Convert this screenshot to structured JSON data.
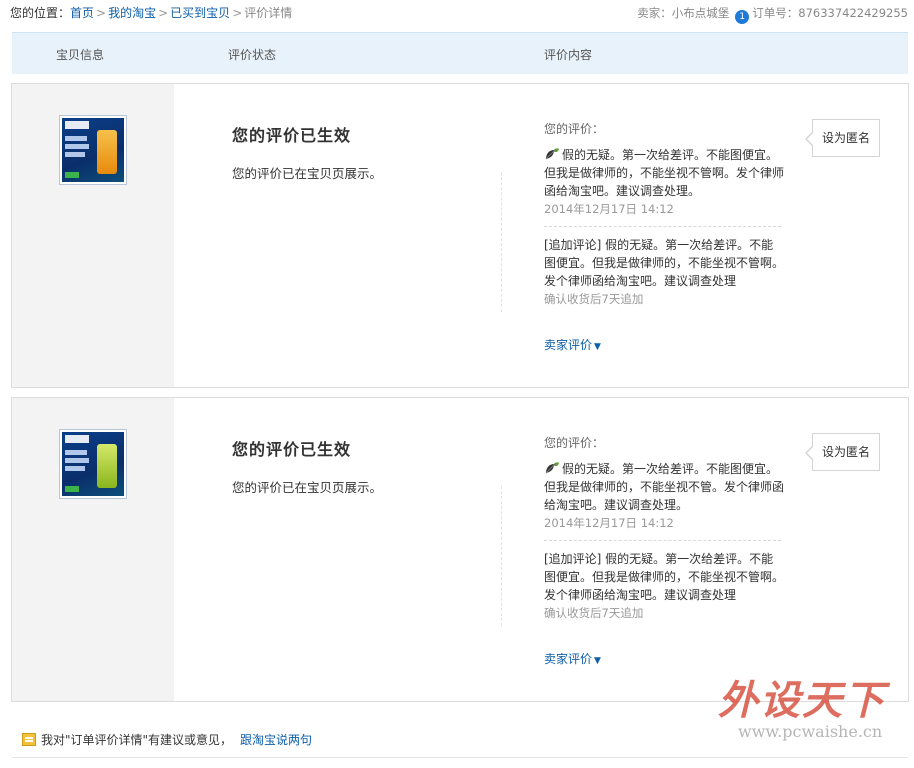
{
  "breadcrumb": {
    "prefix": "您的位置：",
    "items": [
      "首页",
      "我的淘宝",
      "已买到宝贝"
    ],
    "current": "评价详情",
    "sep": ">"
  },
  "seller_info": {
    "seller_label": "卖家：",
    "seller_name": "小布点城堡",
    "order_label": "订单号：",
    "order_no": "876337422429255",
    "ww_icon": "1"
  },
  "table_header": {
    "col1": "宝贝信息",
    "col2": "评价状态",
    "col3": "评价内容"
  },
  "reviews": [
    {
      "thumb_color": "#f4a21c",
      "status_title": "您的评价已生效",
      "status_desc": "您的评价已在宝贝页展示。",
      "my_review_label": "您的评价：",
      "line1": "假的无疑。第一次给差评。不能图便宜。",
      "line2": "但我是做律师的，不能坐视不管啊。发个律师",
      "line3": "函给淘宝吧。建议调查处理。",
      "date": "2014年12月17日 14:12",
      "add_line1": "[追加评论] 假的无疑。第一次给差评。不能",
      "add_line2": "图便宜。但我是做律师的，不能坐视不管啊。",
      "add_line3": "发个律师函给淘宝吧。建议调查处理",
      "add_hint": "确认收货后7天追加",
      "seller_review": "卖家评价",
      "anon_button": "设为匿名"
    },
    {
      "thumb_color": "#a9d232",
      "status_title": "您的评价已生效",
      "status_desc": "您的评价已在宝贝页展示。",
      "my_review_label": "您的评价：",
      "line1": "假的无疑。第一次给差评。不能图便宜。",
      "line2": "但我是做律师的，不能坐视不管。发个律师函",
      "line3": "给淘宝吧。建议调查处理。",
      "date": "2014年12月17日 14:12",
      "add_line1": "[追加评论] 假的无疑。第一次给差评。不能",
      "add_line2": "图便宜。但我是做律师的，不能坐视不管啊。",
      "add_line3": "发个律师函给淘宝吧。建议调查处理",
      "add_hint": "确认收货后7天追加",
      "seller_review": "卖家评价",
      "anon_button": "设为匿名"
    }
  ],
  "footer": {
    "text": "我对\"订单评价详情\"有建议或意见，",
    "link": "跟淘宝说两句"
  },
  "watermark": {
    "big": "外设天下",
    "small": "www.pcwaishe.cn"
  }
}
